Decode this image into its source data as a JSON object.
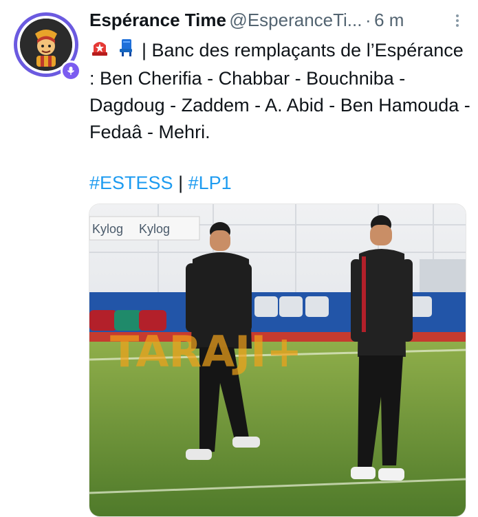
{
  "author": {
    "name": "Espérance Time",
    "handle": "@EsperanceTi...",
    "separator": "·",
    "time": "6 m",
    "avatar_icon": "esperance-mascot-avatar",
    "badge_icon": "microphone-badge-icon"
  },
  "tweet": {
    "emoji": [
      "rotating-light-icon",
      "seat-icon"
    ],
    "text": "| Banc des remplaçants de l’Espérance : Ben Cherifia - Chabbar - Bouchniba - Dagdoug - Zaddem - A. Abid - Ben Hamouda - Fedaâ - Mehri.",
    "hashtags": [
      "#ESTESS",
      "#LP1"
    ],
    "hashtag_separator": "|"
  },
  "media": {
    "banner_text": [
      "Kylog",
      "Kylog"
    ],
    "watermark": "TARAJI+"
  },
  "colors": {
    "link": "#1d9bf0",
    "muted": "#536471",
    "badge": "#7b5cf0"
  }
}
